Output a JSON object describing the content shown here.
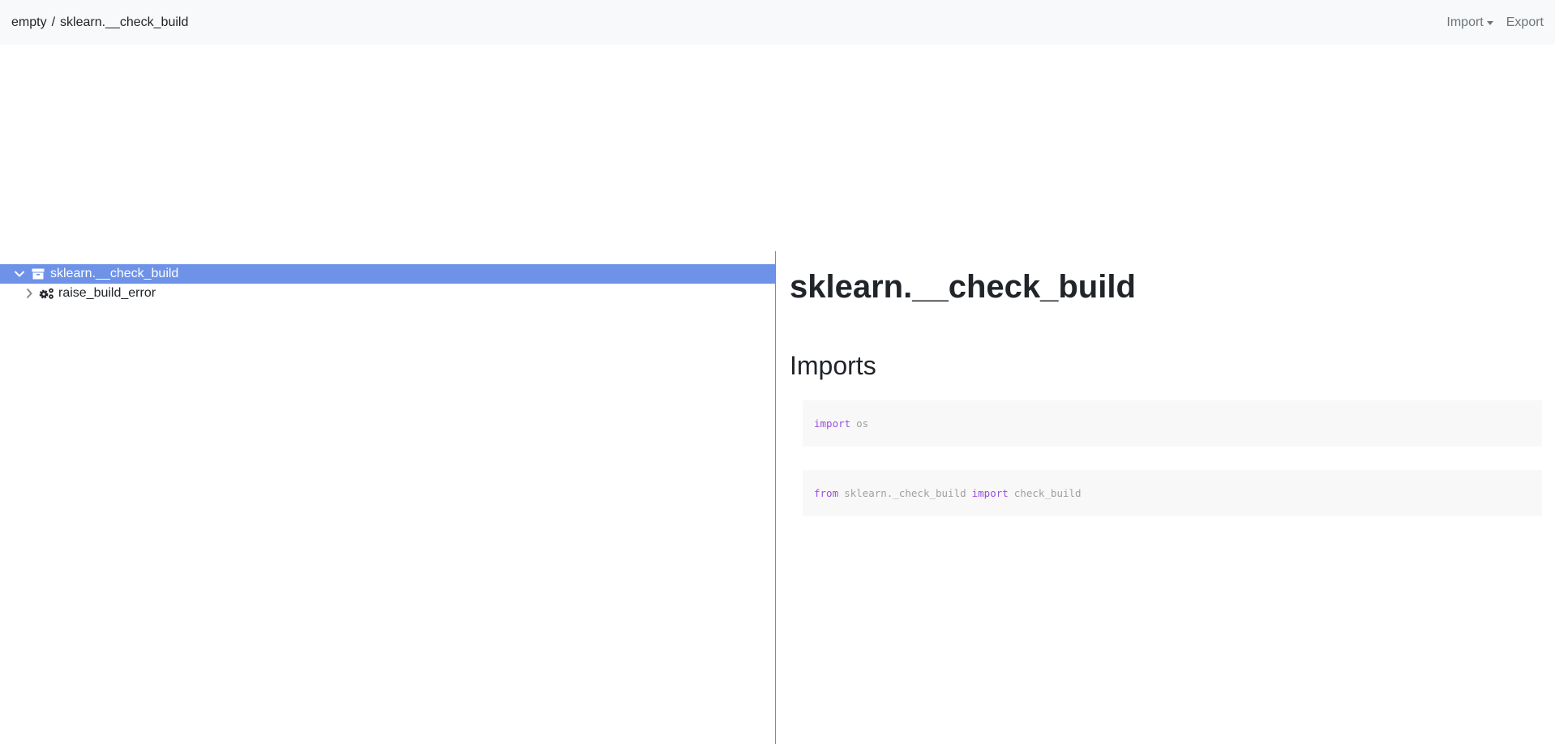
{
  "navbar": {
    "breadcrumb": {
      "root": "empty",
      "separator": "/",
      "current": "sklearn.__check_build"
    },
    "import_label": "Import",
    "export_label": "Export"
  },
  "tree": {
    "items": [
      {
        "label": "sklearn.__check_build",
        "icon": "archive-icon",
        "expanded": true,
        "selected": true
      },
      {
        "label": "raise_build_error",
        "icon": "gears-icon",
        "expanded": false,
        "selected": false
      }
    ]
  },
  "detail": {
    "title": "sklearn.__check_build",
    "imports_heading": "Imports",
    "imports": [
      {
        "kw1": "import",
        "mod": "os"
      },
      {
        "kw1": "from",
        "mod": "sklearn._check_build",
        "kw2": "import",
        "name": "check_build"
      }
    ]
  },
  "colors": {
    "selected_row": "#6d92e8",
    "keyword": "#9b4fe0",
    "navbar_bg": "#f8f9fa"
  }
}
